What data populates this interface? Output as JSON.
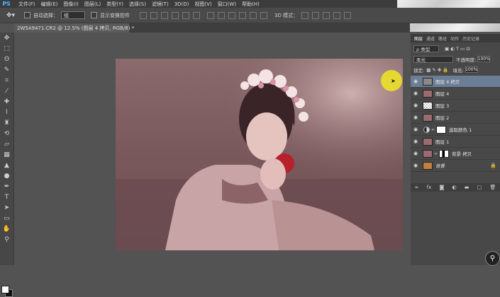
{
  "app": {
    "logo": "PS"
  },
  "menu": [
    "文件(F)",
    "编辑(E)",
    "图像(I)",
    "图层(L)",
    "类型(Y)",
    "选择(S)",
    "滤镜(T)",
    "3D(D)",
    "视图(V)",
    "窗口(W)",
    "帮助(H)"
  ],
  "options": {
    "auto_select_label": "自动选择：",
    "auto_select_value": "组",
    "show_transform_label": "显示变换控件",
    "mode_3d_label": "3D 模式："
  },
  "document": {
    "tab_title": "2W5A9471.CR2 @ 12.5% (图层 4 拷贝, RGB/8) *"
  },
  "panel": {
    "tabs": [
      "图层",
      "通道",
      "路径",
      "动作",
      "历史记录"
    ],
    "filter_kind": "ρ 类型",
    "blend_mode": "柔光",
    "opacity_label": "不透明度:",
    "opacity_value": "100%",
    "lock_label": "锁定:",
    "fill_label": "填充:",
    "fill_value": "100%"
  },
  "layers": [
    {
      "name": "图层 4 拷贝",
      "selected": true,
      "thumb": "#8a8a8a"
    },
    {
      "name": "图层 4",
      "selected": false,
      "thumb": "#9a6c70"
    },
    {
      "name": "图层 3",
      "selected": false,
      "thumb": "checker"
    },
    {
      "name": "图层 2",
      "selected": false,
      "thumb": "#9a6c70"
    },
    {
      "name": "选取颜色 1",
      "selected": false,
      "thumb": "adjust"
    },
    {
      "name": "图层 1",
      "selected": false,
      "thumb": "#9a6c70"
    },
    {
      "name": "背景 拷贝",
      "selected": false,
      "thumb": "#9a6c70"
    },
    {
      "name": "背景",
      "selected": false,
      "thumb": "#c08040"
    }
  ],
  "colors": {
    "accent": "#6c7e96",
    "cursor_highlight": "#ebe128"
  }
}
